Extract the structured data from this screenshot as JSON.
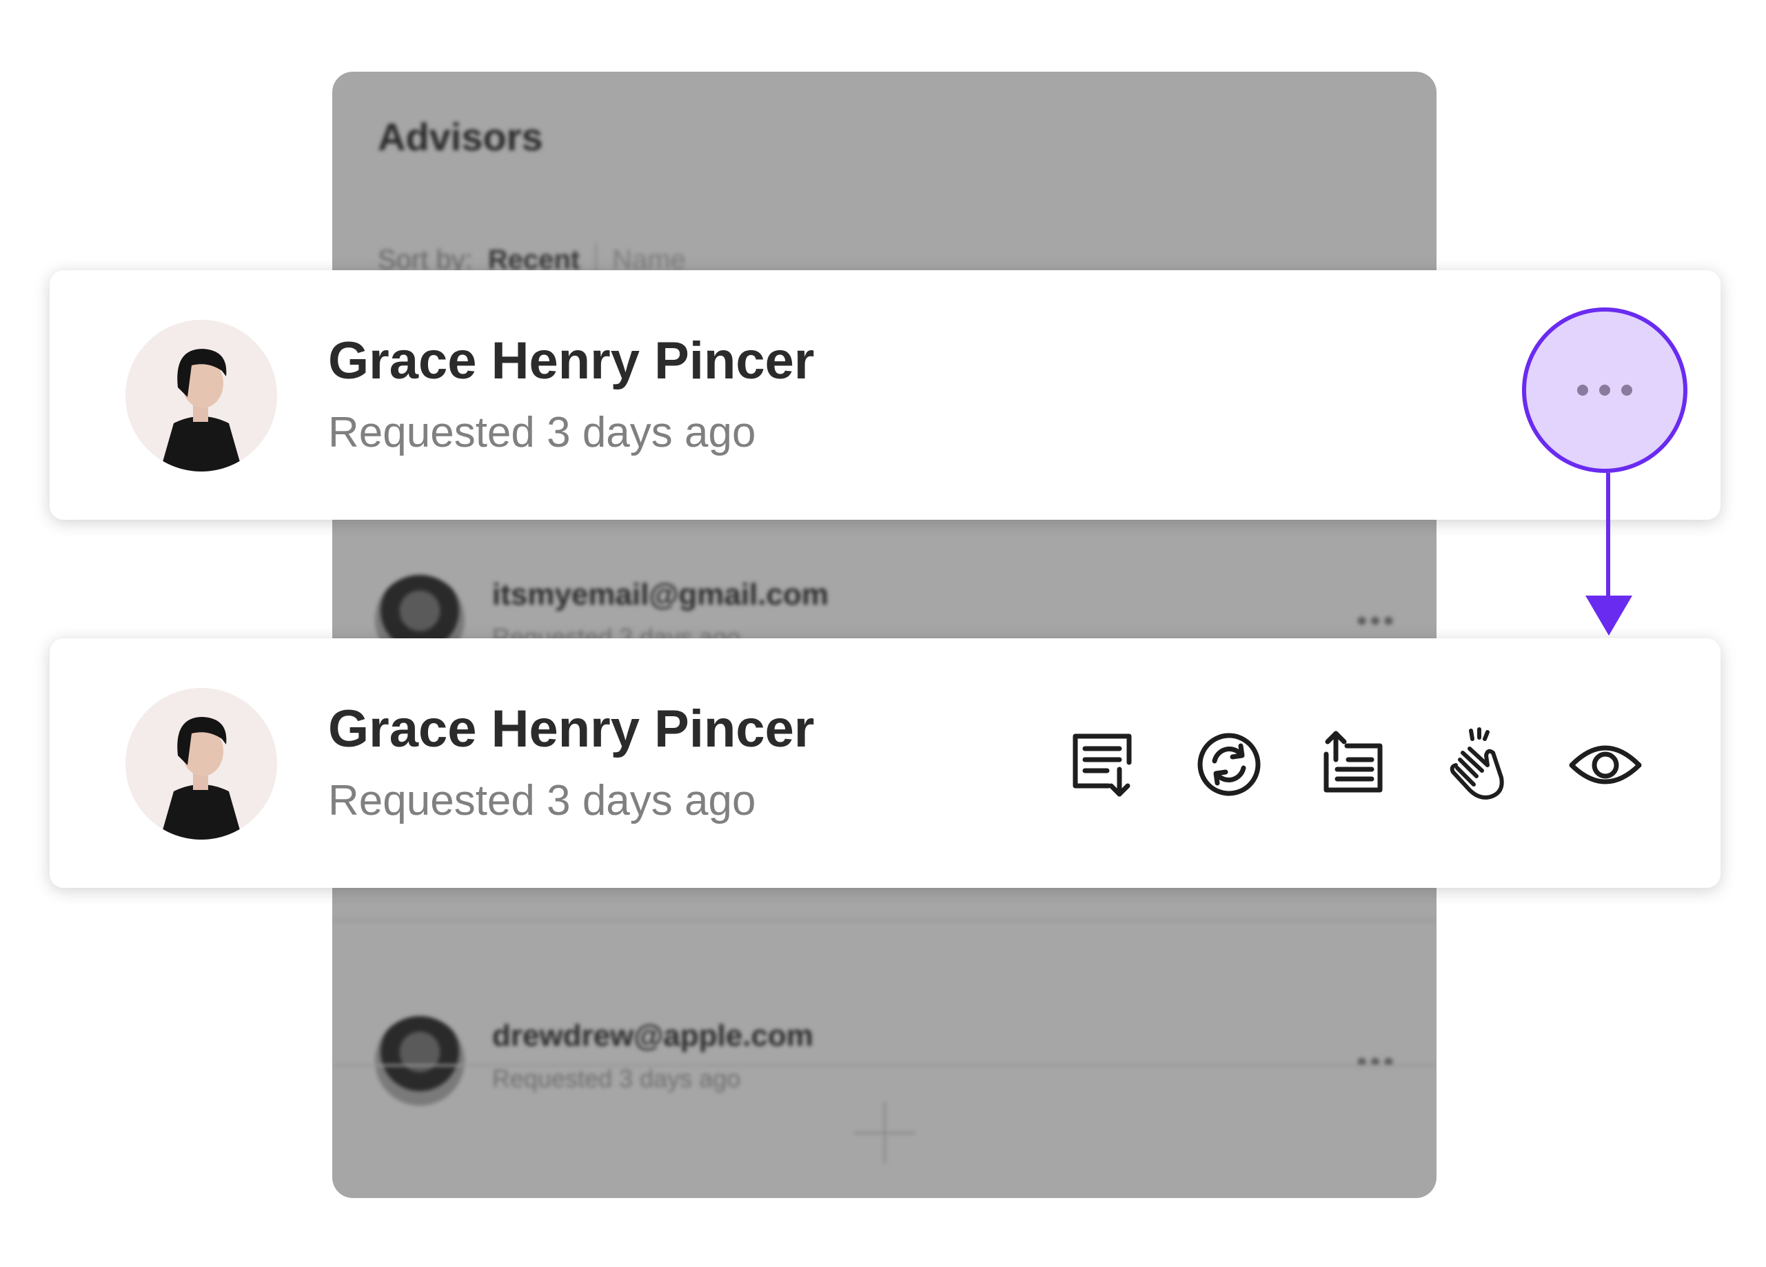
{
  "panel": {
    "title": "Advisors",
    "sort_label": "Sort by:",
    "sort_selected": "Recent",
    "sort_other": "Name",
    "rows": [
      {
        "email": "itsmyemail@gmail.com",
        "requested": "Requested 3 days ago"
      },
      {
        "email": "drewdrew@apple.com",
        "requested": "Requested 3 days ago"
      }
    ]
  },
  "card_top": {
    "name": "Grace Henry Pincer",
    "requested": "Requested 3 days ago"
  },
  "card_bottom": {
    "name": "Grace Henry Pincer",
    "requested": "Requested 3 days ago",
    "actions": [
      "download-notes-icon",
      "refresh-icon",
      "upload-list-icon",
      "clap-icon",
      "eye-icon"
    ]
  },
  "colors": {
    "accent": "#6a2bf0",
    "accent_fill": "#e2d4fc",
    "panel_bg": "#a6a6a6"
  }
}
